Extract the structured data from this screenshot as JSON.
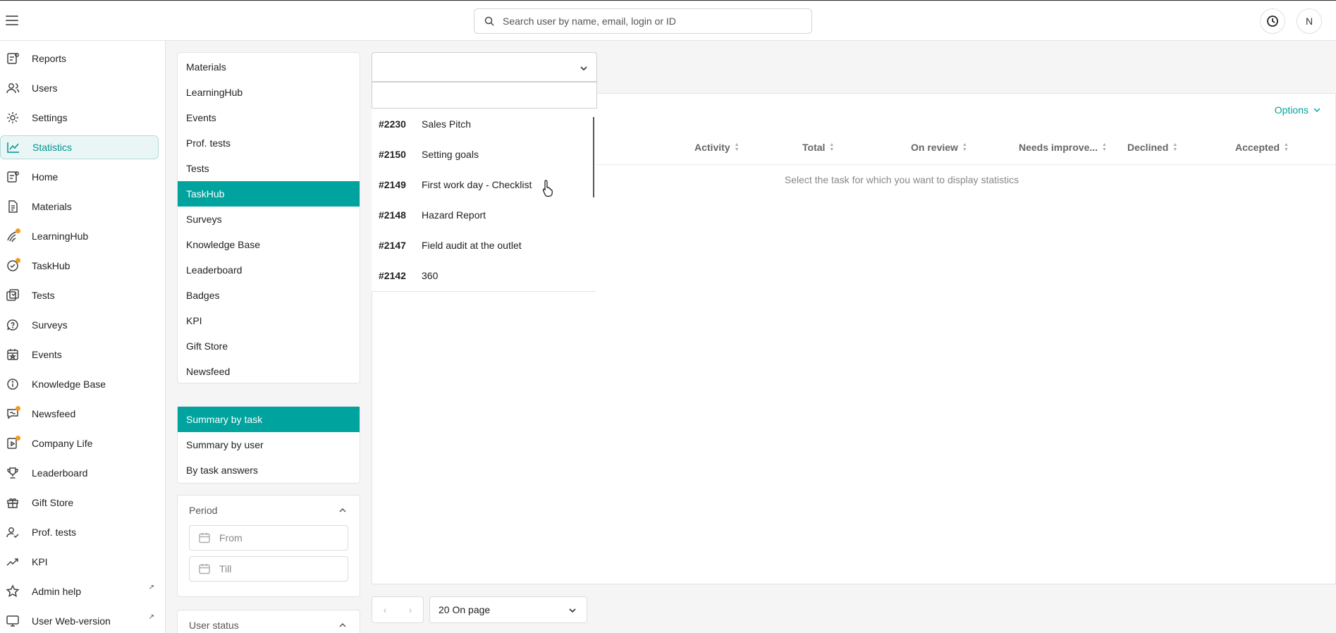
{
  "search": {
    "placeholder": "Search user by name, email, login or ID"
  },
  "header": {
    "avatar_initial": "N"
  },
  "nav": [
    {
      "label": "Reports",
      "icon": "reports-icon"
    },
    {
      "label": "Users",
      "icon": "users-icon"
    },
    {
      "label": "Settings",
      "icon": "gear-icon"
    },
    {
      "label": "Statistics",
      "icon": "chart-line-icon",
      "active": true
    },
    {
      "label": "Home",
      "icon": "home-icon"
    },
    {
      "label": "Materials",
      "icon": "document-icon"
    },
    {
      "label": "LearningHub",
      "icon": "learning-icon",
      "badge": true
    },
    {
      "label": "TaskHub",
      "icon": "task-icon",
      "badge": true
    },
    {
      "label": "Tests",
      "icon": "tests-icon"
    },
    {
      "label": "Surveys",
      "icon": "survey-icon"
    },
    {
      "label": "Events",
      "icon": "calendar-icon"
    },
    {
      "label": "Knowledge Base",
      "icon": "info-icon"
    },
    {
      "label": "Newsfeed",
      "icon": "newsfeed-icon",
      "badge": true
    },
    {
      "label": "Company Life",
      "icon": "company-life-icon",
      "badge": true
    },
    {
      "label": "Leaderboard",
      "icon": "trophy-icon"
    },
    {
      "label": "Gift Store",
      "icon": "gift-icon"
    },
    {
      "label": "Prof. tests",
      "icon": "prof-tests-icon"
    },
    {
      "label": "KPI",
      "icon": "trend-icon"
    },
    {
      "label": "Admin help",
      "icon": "star-icon",
      "external": true
    },
    {
      "label": "User Web-version",
      "icon": "monitor-icon",
      "external": true
    }
  ],
  "sections": [
    "Materials",
    "LearningHub",
    "Events",
    "Prof. tests",
    "Tests",
    "TaskHub",
    "Surveys",
    "Knowledge Base",
    "Leaderboard",
    "Badges",
    "KPI",
    "Gift Store",
    "Newsfeed"
  ],
  "active_section": "TaskHub",
  "views": [
    "Summary by task",
    "Summary by user",
    "By task answers"
  ],
  "active_view": "Summary by task",
  "period": {
    "label": "Period",
    "from_placeholder": "From",
    "till_placeholder": "Till"
  },
  "user_status": {
    "label": "User status"
  },
  "task_dropdown": {
    "items": [
      {
        "id": "#2230",
        "name": "Sales Pitch"
      },
      {
        "id": "#2150",
        "name": "Setting goals"
      },
      {
        "id": "#2149",
        "name": "First work day - Checklist"
      },
      {
        "id": "#2148",
        "name": "Hazard Report"
      },
      {
        "id": "#2147",
        "name": "Field audit at the outlet"
      },
      {
        "id": "#2142",
        "name": "360"
      }
    ]
  },
  "table": {
    "options_label": "Options",
    "columns": [
      "Activity",
      "Total",
      "On review",
      "Needs improve...",
      "Declined",
      "Accepted"
    ],
    "empty_message": "Select the task for which you want to display statistics"
  },
  "pagination": {
    "per_page": "20 On page"
  },
  "colors": {
    "accent": "#00a39e",
    "badge": "#f39a1f"
  }
}
